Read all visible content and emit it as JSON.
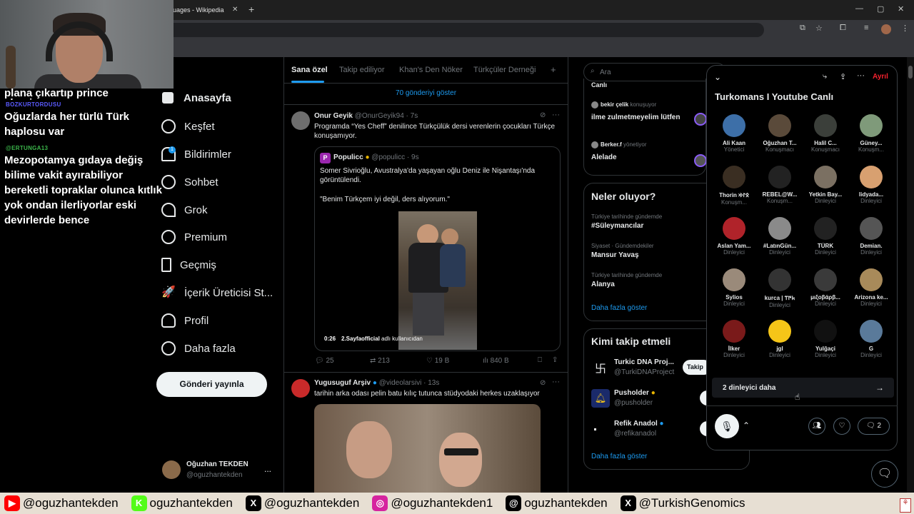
{
  "browser": {
    "tab_title": "uages - Wikipedia",
    "new_tab": "+"
  },
  "chat": {
    "line_top": "plana çıkartıp prince abaniyorum",
    "msg1_user": "BOZKURTORDUSU",
    "msg1": "Oğuzlarda her türlü Türk haplosu var",
    "msg2_user": "@ERTUNGA13",
    "msg2": "Mezopotamya gıdaya değiş bilime vakit ayırabiliyor bereketli topraklar olunca kıtlık yok ondan ilerliyorlar eski devirlerde bence"
  },
  "nav": {
    "items": [
      "Anasayfa",
      "Keşfet",
      "Bildirimler",
      "Sohbet",
      "Grok",
      "Premium",
      "Geçmiş",
      "İçerik Üreticisi St...",
      "Profil",
      "Daha fazla"
    ],
    "badge": "1",
    "post": "Gönderi yayınla",
    "user_name": "Oğuzhan TEKDEN",
    "user_handle": "@oguzhantekden",
    "more": "..."
  },
  "feed": {
    "tabs": [
      "Sana özel",
      "Takip ediliyor",
      "Khan's Den Nöker",
      "Türkçüler Derneği"
    ],
    "add": "+",
    "show_more": "70 gönderiyi göster",
    "t1": {
      "name": "Onur Geyik",
      "handle": "@OnurGeyik94 · 7s",
      "text": "Programda “Yes Cheff” denilince Türkçülük dersi verenlerin çocukları Türkçe konuşamıyor.",
      "q_name": "Populicc",
      "q_handle": "@populicc · 9s",
      "q_text1": "Somer Sivrioğlu, Avustralya'da yaşayan oğlu Deniz ile Nişantaşı'nda görüntülendi.",
      "q_text2": "\"Benim Türkçem iyi değil, ders alıyorum.\"",
      "video_time": "0:26",
      "video_credit": "2.Sayfaofficial",
      "video_credit_suffix": "adlı kullanıcıdan",
      "replies": "25",
      "retweets": "213",
      "likes": "19 B",
      "views": "840 B"
    },
    "t2": {
      "name": "Yugusuguf Arşiv",
      "handle": "@videolarsivi · 13s",
      "text": "tarihin arka odası pelin batu kılıç tutunca stüdyodaki herkes uzaklaşıyor"
    }
  },
  "right": {
    "search": "Ara",
    "live_top": "Canlı",
    "live1_user": "bekir çelik",
    "live1_role": "konuşuyor",
    "live1_text": "ilme zulmetmeyelim lütfen",
    "live2_user": "Berker.f",
    "live2_role": "yönetiyor",
    "live2_text": "Alelade",
    "trends_title": "Neler oluyor?",
    "trends": [
      {
        "ctx": "Türkiye tarihinde gündemde",
        "name": "#Süleymancılar"
      },
      {
        "ctx": "Siyaset · Gündemdekiler",
        "name": "Mansur Yavaş"
      },
      {
        "ctx": "Türkiye tarihinde gündemde",
        "name": "Alanya"
      }
    ],
    "more": "Daha fazla göster",
    "who_title": "Kimi takip etmeli",
    "who": [
      {
        "name": "Turkic DNA Proj...",
        "handle": "@TurkiDNAProject",
        "btn": "Takip"
      },
      {
        "name": "Pusholder",
        "handle": "@pusholder",
        "btn": ""
      },
      {
        "name": "Refik Anadol",
        "handle": "@refikanadol",
        "btn": ""
      }
    ],
    "more2": "Daha fazla göster"
  },
  "space": {
    "title": "Turkomans I Youtube Canlı",
    "leave": "Ayrıl",
    "speakers": [
      {
        "n": "Ali Kaan",
        "r": "Yönetici",
        "c": "#3d6fa8"
      },
      {
        "n": "Oğuzhan T...",
        "r": "Konuşmacı",
        "c": "#5a4a3a"
      },
      {
        "n": "Halil C...",
        "r": "Konuşmacı",
        "c": "#3b3f3a"
      },
      {
        "n": "Güney...",
        "r": "Konuşm...",
        "c": "#7f9a7a"
      },
      {
        "n": "Thorin 𐰋𐰃𐰢",
        "r": "Konuşm...",
        "c": "#3a2e22"
      },
      {
        "n": "REBEL@W...",
        "r": "Konuşm...",
        "c": "#222"
      },
      {
        "n": "Yetkin Bay...",
        "r": "Dinleyici",
        "c": "#7b7062"
      },
      {
        "n": "lidyada...",
        "r": "Dinleyici",
        "c": "#d8a070"
      },
      {
        "n": "Aslan Yam...",
        "r": "Dinleyici",
        "c": "#b0232a"
      },
      {
        "n": "#LatınGün...",
        "r": "Dinleyici",
        "c": "#8a8a8a"
      },
      {
        "n": "TÜRK",
        "r": "Dinleyici",
        "c": "#222"
      },
      {
        "n": "Demian.",
        "r": "Dinleyici",
        "c": "#555"
      },
      {
        "n": "Sylios",
        "r": "Dinleyici",
        "c": "#9a8a7a"
      },
      {
        "n": "kurca | 𐱅𐰇𐰼",
        "r": "Dinleyici",
        "c": "#333"
      },
      {
        "n": "μιξοβάρβ...",
        "r": "Dinleyici",
        "c": "#3a3a3a"
      },
      {
        "n": "Arizona ke...",
        "r": "Dinleyici",
        "c": "#a88a5a"
      },
      {
        "n": "İlker",
        "r": "Dinleyici",
        "c": "#7a1a1a"
      },
      {
        "n": "jgl",
        "r": "Dinleyici",
        "c": "#f5c518"
      },
      {
        "n": "Yulğaçi",
        "r": "Dinleyici",
        "c": "#111"
      },
      {
        "n": "G",
        "r": "Dinleyici",
        "c": "#5a7a9a"
      }
    ],
    "more_listeners": "2 dinleyici daha",
    "comments": "2"
  },
  "banner": [
    {
      "label": "@oguzhantekden",
      "icon": "youtube-icon",
      "color": "#ff0000"
    },
    {
      "label": "oguzhantekden",
      "icon": "kick-icon",
      "color": "#53fc18"
    },
    {
      "label": "@oguzhantekden",
      "icon": "x-icon",
      "color": "#000000"
    },
    {
      "label": "@oguzhantekden1",
      "icon": "instagram-icon",
      "color": "#d6249f"
    },
    {
      "label": "oguzhantekden",
      "icon": "threads-icon",
      "color": "#000000"
    },
    {
      "label": "@TurkishGenomics",
      "icon": "x-icon",
      "color": "#000000"
    }
  ]
}
